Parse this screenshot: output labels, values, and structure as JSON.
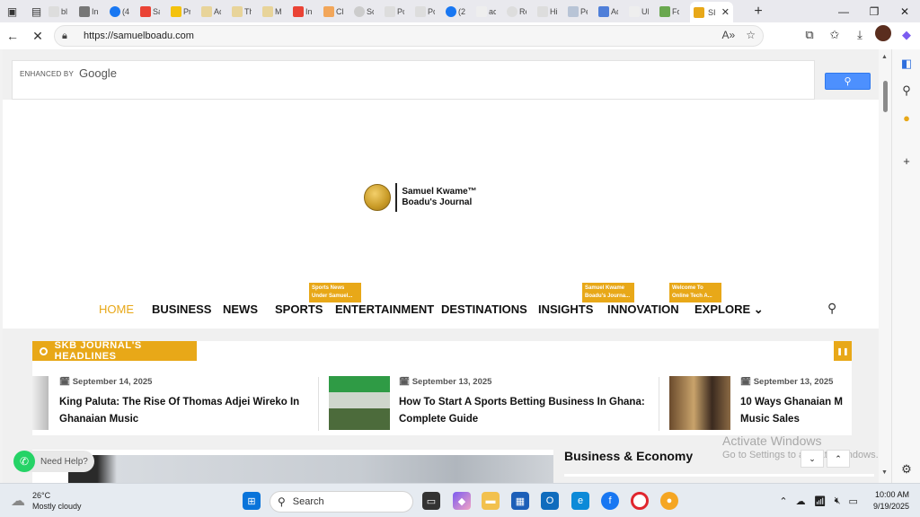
{
  "browser": {
    "active_tab_label": "SI",
    "url": "https://samuelboadu.com",
    "tab_labels": [
      "bl",
      "In",
      "(4",
      "Sa",
      "Pr",
      "Ac",
      "Th",
      "M",
      "In",
      "Cl",
      "Sc",
      "Pc",
      "Pc",
      "(2",
      "ac",
      "Re",
      "Hi",
      "Pe",
      "Ac",
      "UI",
      "Fo"
    ],
    "colors": {
      "accent": "#e8a818"
    }
  },
  "page": {
    "search": {
      "enhanced_by": "ENHANCED BY",
      "google": "Google"
    },
    "logo": {
      "line1": "Samuel Kwame™",
      "line2": "Boadu's Journal"
    },
    "menu": {
      "items": [
        "HOME",
        "BUSINESS",
        "NEWS",
        "SPORTS",
        "ENTERTAINMENT",
        "DESTINATIONS",
        "INSIGHTS",
        "INNOVATION",
        "EXPLORE"
      ],
      "badges": [
        {
          "text": "Sports News Under Samuel..."
        },
        {
          "text": "Samuel Kwame Boadu's Journa..."
        },
        {
          "text": "Welcome To Online Tech A..."
        }
      ]
    },
    "headlines": {
      "label": "SKB JOURNAL'S HEADLINES",
      "items": [
        {
          "date": "September 14, 2025",
          "title": "King Paluta: The Rise Of Thomas Adjei Wireko In Ghanaian Music"
        },
        {
          "date": "September 13, 2025",
          "title": "How To Start A Sports Betting Business In Ghana: Complete Guide"
        },
        {
          "date": "September 13, 2025",
          "title": "10 Ways Ghanaian M Music Sales"
        }
      ]
    },
    "section_title": "Business & Economy",
    "need_help": "Need Help?",
    "watermark": {
      "line1": "Activate Windows",
      "line2": "Go to Settings to activate Windows."
    }
  },
  "taskbar": {
    "weather_temp": "26°C",
    "weather_desc": "Mostly cloudy",
    "search_placeholder": "Search",
    "time": "10:00 AM",
    "date": "9/19/2025"
  }
}
